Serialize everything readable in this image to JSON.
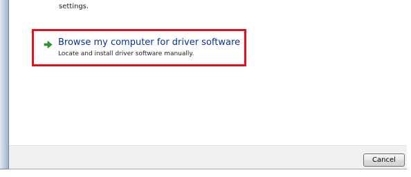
{
  "previous_option": {
    "description_tail": "settings."
  },
  "browse_option": {
    "title": "Browse my computer for driver software",
    "description": "Locate and install driver software manually."
  },
  "footer": {
    "cancel_label": "Cancel"
  },
  "colors": {
    "highlight_border": "#e2111d",
    "link_blue": "#003399",
    "arrow_green": "#2e9b2e",
    "footer_bg": "#f0f0f0"
  },
  "icons": {
    "browse_option": "green-arrow-icon"
  }
}
